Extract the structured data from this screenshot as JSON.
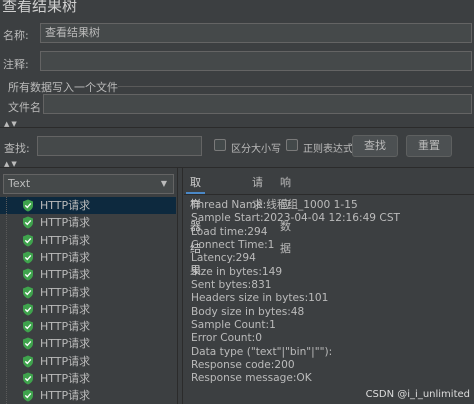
{
  "window": {
    "title": "查看结果树"
  },
  "form": {
    "name_label": "名称:",
    "name_value": "查看结果树",
    "comment_label": "注释:",
    "comment_value": "",
    "file_section_title": "所有数据写入一个文件",
    "filename_label": "文件名",
    "filename_value": ""
  },
  "search": {
    "label": "查找:",
    "value": "",
    "case_sensitive_label": "区分大小写",
    "regex_label": "正则表达式",
    "find_button": "查找",
    "reset_button": "重置"
  },
  "renderer": {
    "selected": "Text"
  },
  "tree": {
    "items": [
      {
        "label": "HTTP请求",
        "status": "success",
        "selected": true
      },
      {
        "label": "HTTP请求",
        "status": "success"
      },
      {
        "label": "HTTP请求",
        "status": "success"
      },
      {
        "label": "HTTP请求",
        "status": "success"
      },
      {
        "label": "HTTP请求",
        "status": "success"
      },
      {
        "label": "HTTP请求",
        "status": "success"
      },
      {
        "label": "HTTP请求",
        "status": "success"
      },
      {
        "label": "HTTP请求",
        "status": "success"
      },
      {
        "label": "HTTP请求",
        "status": "success"
      },
      {
        "label": "HTTP请求",
        "status": "success"
      },
      {
        "label": "HTTP请求",
        "status": "success"
      },
      {
        "label": "HTTP请求",
        "status": "success"
      }
    ]
  },
  "tabs": [
    {
      "label": "取样器结果",
      "active": true
    },
    {
      "label": "请求"
    },
    {
      "label": "响应数据"
    }
  ],
  "sampler_result": [
    "Thread Name:线程组_1000 1-15",
    "Sample Start:2023-04-04 12:16:49 CST",
    "Load time:294",
    "Connect Time:1",
    "Latency:294",
    "Size in bytes:149",
    "Sent bytes:831",
    "Headers size in bytes:101",
    "Body size in bytes:48",
    "Sample Count:1",
    "Error Count:0",
    "Data type (\"text\"|\"bin\"|\"\"):",
    "Response code:200",
    "Response message:OK"
  ],
  "watermark": "CSDN @i_i_unlimited",
  "colors": {
    "success_icon": "#3fa34d",
    "selected_row": "#0d293e",
    "tab_accent": "#4a88c7"
  }
}
